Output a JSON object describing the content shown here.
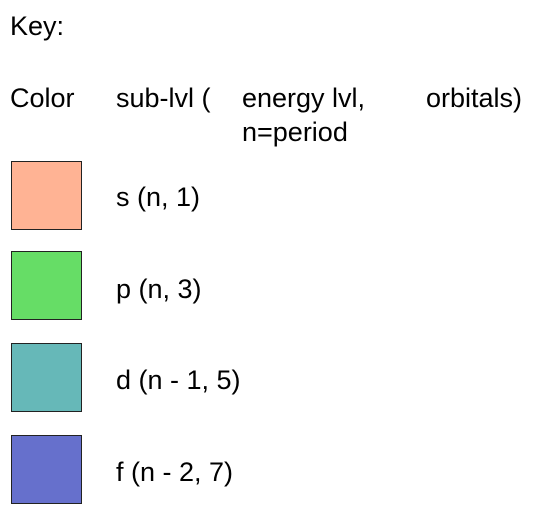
{
  "key": {
    "title": "Key:",
    "headers": {
      "color": "Color",
      "sublvl": "sub-lvl (",
      "energy_line1": "energy lvl,",
      "energy_line2": "n=period",
      "orbitals": "orbitals)"
    },
    "rows": [
      {
        "label": "s (n, 1)",
        "color": "#FFB394"
      },
      {
        "label": "p (n, 3)",
        "color": "#66DD66"
      },
      {
        "label": "d (n - 1, 5)",
        "color": "#66B8B8"
      },
      {
        "label": "f (n - 2, 7)",
        "color": "#6670CC"
      }
    ]
  }
}
